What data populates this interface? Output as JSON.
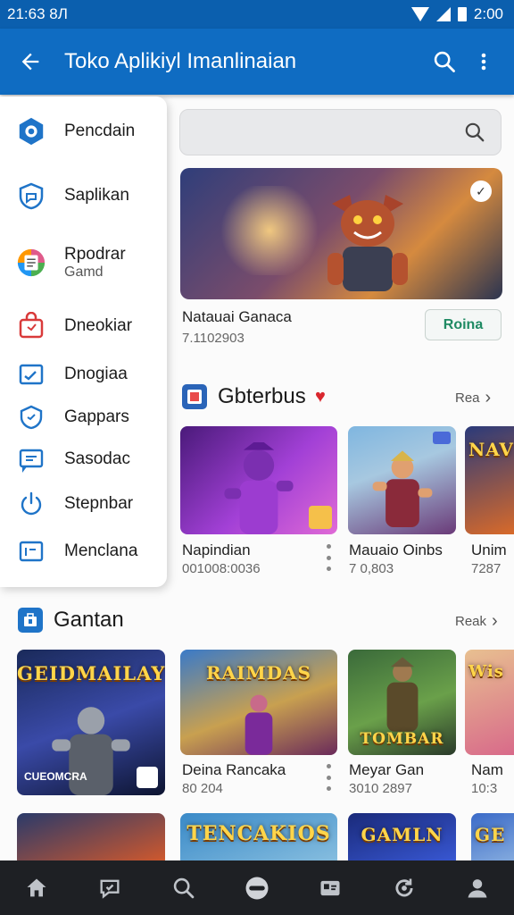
{
  "status_bar": {
    "time_left": "21:63 8Л",
    "time_right": "2:00"
  },
  "app_bar": {
    "title": "Toko Aplikiyl Imanlinaian"
  },
  "drawer": {
    "items": [
      {
        "label": "Pencdain",
        "sub": "",
        "icon": "hexagon-icon",
        "color": "#1f74c8"
      },
      {
        "label": "Saplikan",
        "sub": "",
        "icon": "shield-chat-icon",
        "color": "#1f74c8"
      },
      {
        "label": "Rpodrar",
        "sub": "Gamd",
        "icon": "colorful-doc-icon",
        "color": "#e05a8a"
      },
      {
        "label": "Dneokiar",
        "sub": "",
        "icon": "bag-icon",
        "color": "#d93a3a"
      },
      {
        "label": "Dnogiaa",
        "sub": "",
        "icon": "wave-box-icon",
        "color": "#1f74c8"
      },
      {
        "label": "Gappars",
        "sub": "",
        "icon": "shield-outline-icon",
        "color": "#1f74c8"
      },
      {
        "label": "Sasodac",
        "sub": "",
        "icon": "message-box-icon",
        "color": "#1f74c8"
      },
      {
        "label": "Stepnbar",
        "sub": "",
        "icon": "power-icon",
        "color": "#1f74c8"
      },
      {
        "label": "Menclana",
        "sub": "",
        "icon": "tag-box-icon",
        "color": "#1f74c8"
      }
    ]
  },
  "search": {
    "placeholder": ""
  },
  "hero": {
    "title": "Natauai Ganaca",
    "subtitle": "7.1102903",
    "button": "Roina"
  },
  "section1": {
    "title": "Gbterbus",
    "more": "Rea",
    "cards": [
      {
        "title": "Napindian",
        "sub": "001008:0036",
        "logo": ""
      },
      {
        "title": "Mauaio Oinbs",
        "sub": "7 0,803",
        "logo": ""
      },
      {
        "title": "Unim",
        "sub": "7287",
        "logo": "NAV"
      }
    ]
  },
  "section2": {
    "title": "Gantan",
    "more": "Reak",
    "cards": [
      {
        "title": "",
        "sub": "",
        "logo": "GEIDMAILAY",
        "caption": "CUEOMCRA"
      },
      {
        "title": "Deina Rancaka",
        "sub": "80 204",
        "logo": "RAIMDAS"
      },
      {
        "title": "Meyar Gan",
        "sub": "3010 2897",
        "logo": "TOMBAR"
      },
      {
        "title": "Nam",
        "sub": "10:3",
        "logo": "Wis"
      }
    ]
  },
  "section3": {
    "cards": [
      {
        "logo": ""
      },
      {
        "logo": "TENCAKIOS"
      },
      {
        "logo": "GAMLN"
      },
      {
        "logo": "GE"
      }
    ]
  },
  "colors": {
    "primary": "#0f6cc2",
    "status": "#0b5fae",
    "nav": "#1e2024"
  }
}
